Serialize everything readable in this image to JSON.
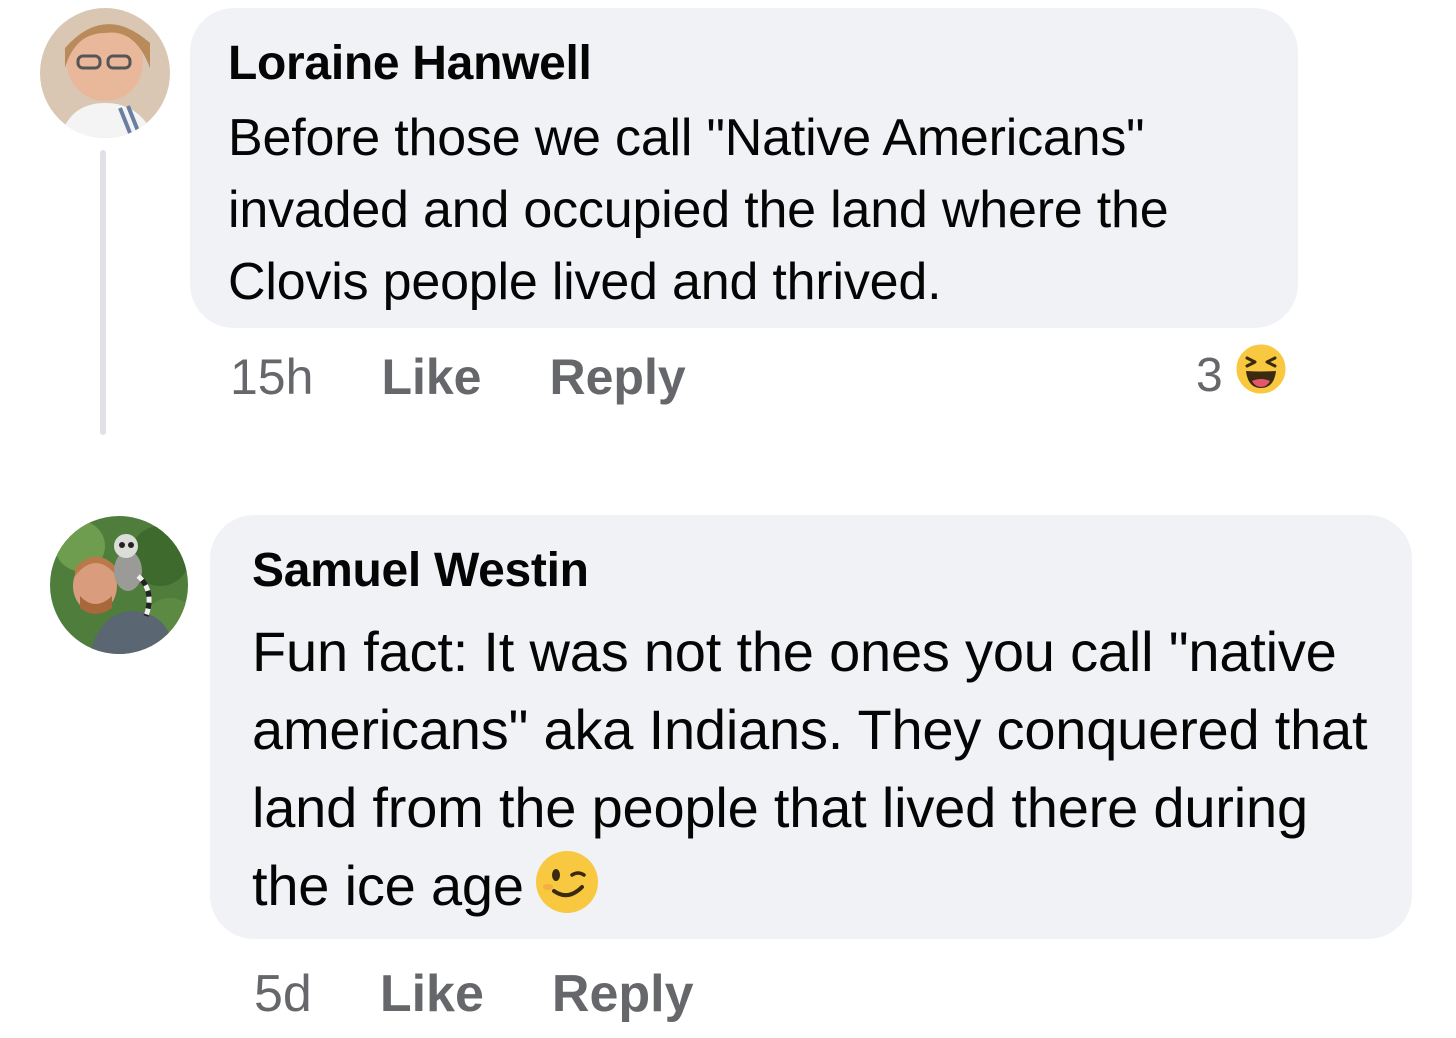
{
  "comments": [
    {
      "author": "Loraine Hanwell",
      "text": "Before those we call \"Native Americans\" invaded and occupied the land where the Clovis people lived and thrived.",
      "time": "15h",
      "like_label": "Like",
      "reply_label": "Reply",
      "reaction_count": "3",
      "reaction_icon": "laughing-emoji-icon"
    },
    {
      "author": "Samuel Westin",
      "text": "Fun fact: It was not the ones you call \"native americans\" aka Indians. They conquered that land from the people that lived there during the ice age",
      "inline_emoji": "winking-emoji-icon",
      "time": "5d",
      "like_label": "Like",
      "reply_label": "Reply"
    }
  ],
  "colors": {
    "bubble": "#f0f2f5",
    "meta_text": "#65676b",
    "text": "#050505"
  }
}
